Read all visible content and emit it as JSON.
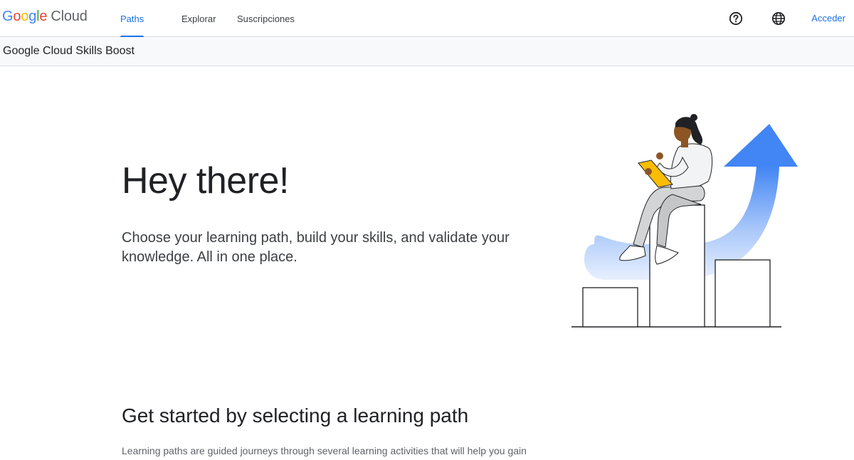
{
  "header": {
    "logo": {
      "g1": "G",
      "o1": "o",
      "o2": "o",
      "g2": "g",
      "l": "l",
      "e": "e",
      "product": "Cloud"
    },
    "tabs": [
      {
        "label": "Paths",
        "active": true
      },
      {
        "label": "Explorar",
        "active": false
      },
      {
        "label": "Suscripciones",
        "active": false
      }
    ],
    "icons": {
      "help": "help-circle-icon",
      "language": "globe-icon"
    },
    "signin_label": "Acceder"
  },
  "subheader": {
    "title": "Google Cloud Skills Boost"
  },
  "hero": {
    "title": "Hey there!",
    "subtitle": "Choose your learning path, build your skills, and validate your knowledge. All in one place."
  },
  "section": {
    "title": "Get started by selecting a learning path",
    "description": "Learning paths are guided journeys through several learning activities that will help you gain"
  },
  "colors": {
    "accent": "#1a73e8",
    "arrow_top": "#4285f4",
    "arrow_bottom": "#e8f0fe",
    "tablet": "#fbbc04"
  }
}
